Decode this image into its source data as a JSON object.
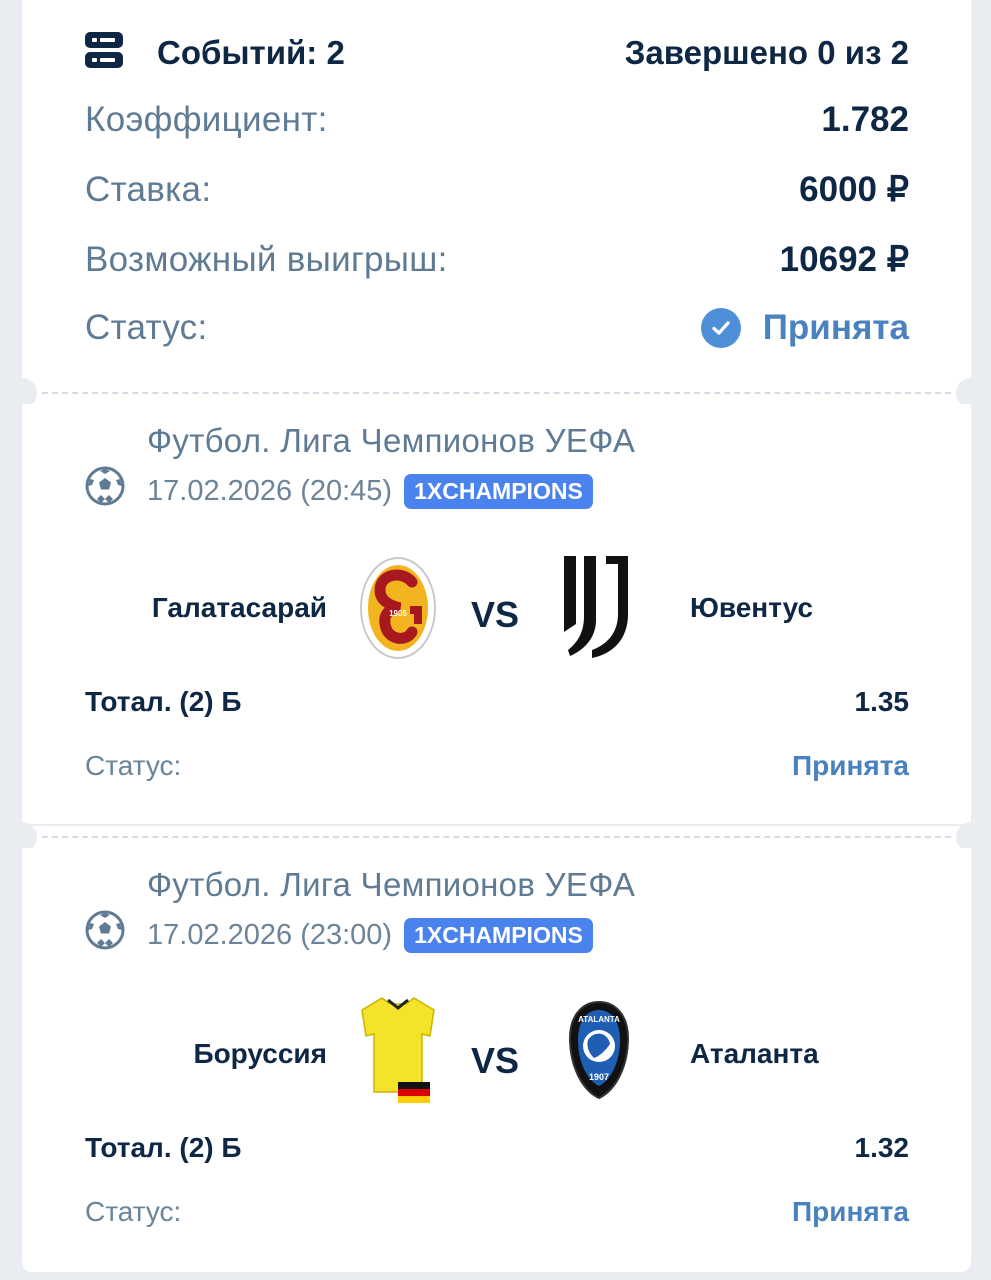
{
  "summary": {
    "events_label": "Событий: 2",
    "completed_label": "Завершено 0 из 2",
    "coef_label": "Коэффициент:",
    "coef_value": "1.782",
    "stake_label": "Ставка:",
    "stake_value": "6000 ₽",
    "win_label": "Возможный выигрыш:",
    "win_value": "10692 ₽",
    "status_label": "Статус:",
    "status_value": "Принята"
  },
  "events": [
    {
      "league": "Футбол. Лига Чемпионов УЕФА",
      "date": "17.02.2026 (20:45)",
      "badge": "1XCHAMPIONS",
      "team1": "Галатасарай",
      "team2": "Ювентус",
      "vs": "VS",
      "bet": "Тотал. (2) Б",
      "coef": "1.35",
      "status_label": "Статус:",
      "status_value": "Принята",
      "logo1_text": "1905"
    },
    {
      "league": "Футбол. Лига Чемпионов УЕФА",
      "date": "17.02.2026 (23:00)",
      "badge": "1XCHAMPIONS",
      "team1": "Боруссия",
      "team2": "Аталанта",
      "vs": "VS",
      "bet": "Тотал. (2) Б",
      "coef": "1.32",
      "status_label": "Статус:",
      "status_value": "Принята",
      "logo2_text_top": "ATALANTA",
      "logo2_text_bottom": "1907"
    }
  ],
  "colors": {
    "accent": "#4a82bf",
    "badge": "#4b83ee",
    "dark_text": "#0e2744",
    "muted_text": "#5f7b94",
    "background": "#e9ecf1"
  },
  "icons": [
    "events-list-icon",
    "check-circle-icon",
    "soccer-ball-icon",
    "galatasaray-logo",
    "juventus-logo",
    "dortmund-kit-logo",
    "germany-flag-icon",
    "atalanta-logo"
  ]
}
